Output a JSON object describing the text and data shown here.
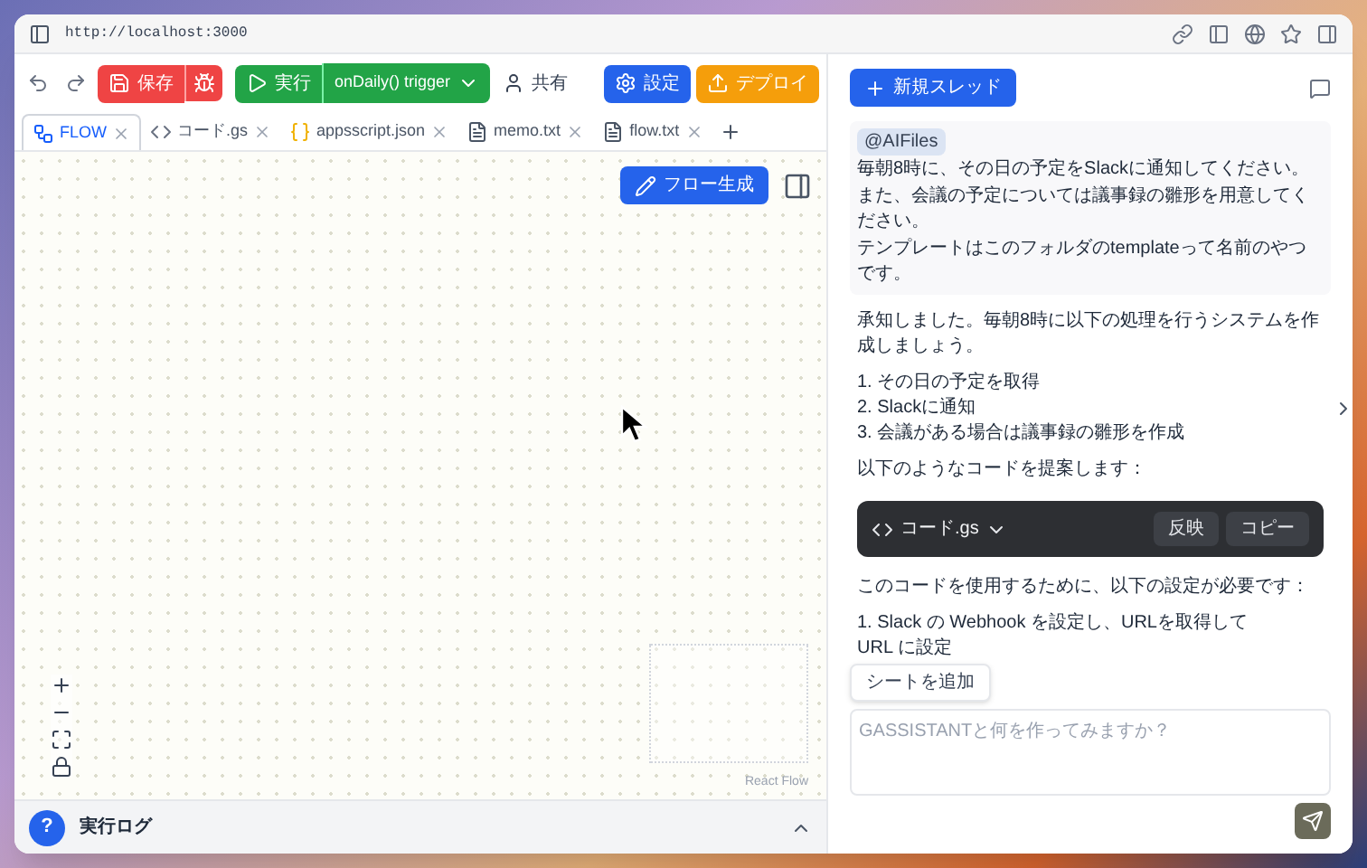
{
  "browser": {
    "url": "http://localhost:3000"
  },
  "toolbar": {
    "save": "保存",
    "run": "実行",
    "trigger": "onDaily() trigger",
    "share": "共有",
    "settings": "設定",
    "deploy": "デプロイ"
  },
  "tabs": [
    {
      "label": "FLOW",
      "kind": "flow",
      "selected": true
    },
    {
      "label": "コード.gs",
      "kind": "code",
      "selected": false
    },
    {
      "label": "appsscript.json",
      "kind": "json",
      "selected": false
    },
    {
      "label": "memo.txt",
      "kind": "text",
      "selected": false
    },
    {
      "label": "flow.txt",
      "kind": "text",
      "selected": false
    }
  ],
  "canvas": {
    "generate_button": "フロー生成",
    "attribution": "React Flow"
  },
  "log_panel": {
    "badge": "?",
    "title": "実行ログ"
  },
  "chat": {
    "new_thread": "新規スレッド",
    "messages": [
      {
        "kind": "user",
        "tag": "@AIFiles",
        "blocks": [
          {
            "kind": "text",
            "text": "毎朝8時に、その日の予定をSlackに通知してください。"
          },
          {
            "kind": "text",
            "text": "また、会議の予定については議事録の雛形を用意してください。"
          },
          {
            "kind": "text",
            "text": "テンプレートはこのフォルダのtemplateって名前のやつです。"
          }
        ]
      },
      {
        "kind": "assistant",
        "blocks": [
          {
            "kind": "text",
            "text": "承知しました。毎朝8時に以下の処理を行うシステムを作成しましょう。"
          },
          {
            "kind": "list",
            "items": [
              "1. その日の予定を取得",
              "2. Slackに通知",
              "3. 会議がある場合は議事録の雛形を作成"
            ]
          },
          {
            "kind": "text",
            "text": "以下のようなコードを提案します："
          },
          {
            "kind": "code",
            "file": "コード.gs",
            "apply": "反映",
            "copy": "コピー"
          },
          {
            "kind": "text",
            "text": "このコードを使用するために、以下の設定が必要です："
          },
          {
            "kind": "list",
            "items": [
              "1. Slack の Webhook を設定し、URLを取得して",
              "URL に設定"
            ]
          }
        ]
      }
    ],
    "popup": "シートを追加",
    "placeholder": "GASSISTANTと何を作ってみますか？"
  }
}
